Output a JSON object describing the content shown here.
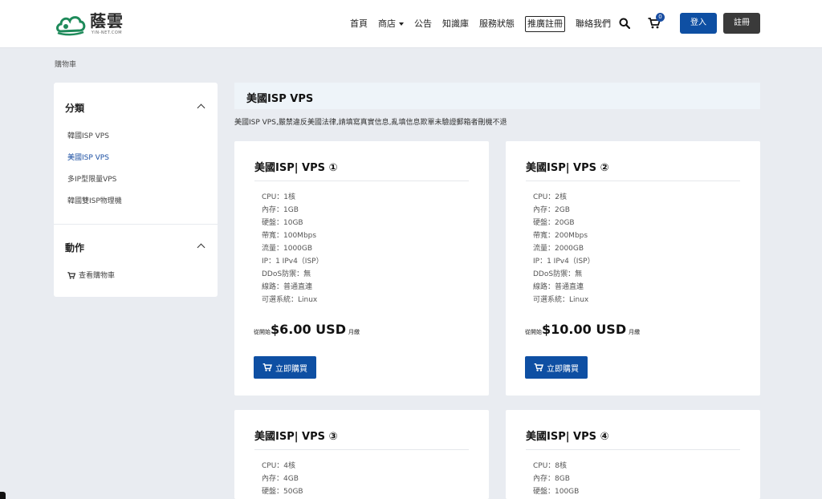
{
  "brand": {
    "name_cn": "蔭雲",
    "name_en": "YIN-NET.COM",
    "color": "#1e8a5a"
  },
  "nav": {
    "items": [
      "首頁",
      "商店",
      "公告",
      "知識庫",
      "服務狀態",
      "推廣註冊",
      "聯絡我們"
    ],
    "cart_count": "0",
    "login_label": "登入",
    "register_label": "註冊"
  },
  "breadcrumb": "購物車",
  "sidebar": {
    "categories_title": "分類",
    "categories": [
      "韓國ISP VPS",
      "美國ISP VPS",
      "多IP型限量VPS",
      "韓國雙ISP物理機"
    ],
    "active_category": "美國ISP VPS",
    "actions_title": "動作",
    "actions": [
      "查看購物車"
    ]
  },
  "category": {
    "title": "美國ISP VPS",
    "description": "美國ISP VPS,嚴禁違反美國法律,請填寫真實信息,亂填信息欺單未驗證郵箱者刪機不退"
  },
  "products": [
    {
      "name": "美國ISP| VPS ①",
      "specs": [
        "CPU：1核",
        "內存：1GB",
        "硬盤：10GB",
        "帶寬：100Mbps",
        "流量：1000GB",
        "IP：1 IPv4（ISP）",
        "DDoS防禦：無",
        "線路：普通直連",
        "可選系統：Linux"
      ],
      "price_prefix": "從開始",
      "price": "$6.00 USD",
      "price_suffix": "月繳",
      "buy_label": "立即購買"
    },
    {
      "name": "美國ISP| VPS ②",
      "specs": [
        "CPU：2核",
        "內存：2GB",
        "硬盤：20GB",
        "帶寬：200Mbps",
        "流量：2000GB",
        "IP：1 IPv4（ISP）",
        "DDoS防禦：無",
        "線路：普通直連",
        "可選系統：Linux"
      ],
      "price_prefix": "從開始",
      "price": "$10.00 USD",
      "price_suffix": "月繳",
      "buy_label": "立即購買"
    },
    {
      "name": "美國ISP| VPS ③",
      "specs": [
        "CPU：4核",
        "內存：4GB",
        "硬盤：50GB"
      ]
    },
    {
      "name": "美國ISP| VPS ④",
      "specs": [
        "CPU：8核",
        "內存：8GB",
        "硬盤：100GB"
      ]
    }
  ],
  "colors": {
    "primary": "#0e4fa3",
    "dark_button": "#3a3a3a",
    "page_bg": "#e9ecf1",
    "category_bar": "#eef4f9"
  }
}
